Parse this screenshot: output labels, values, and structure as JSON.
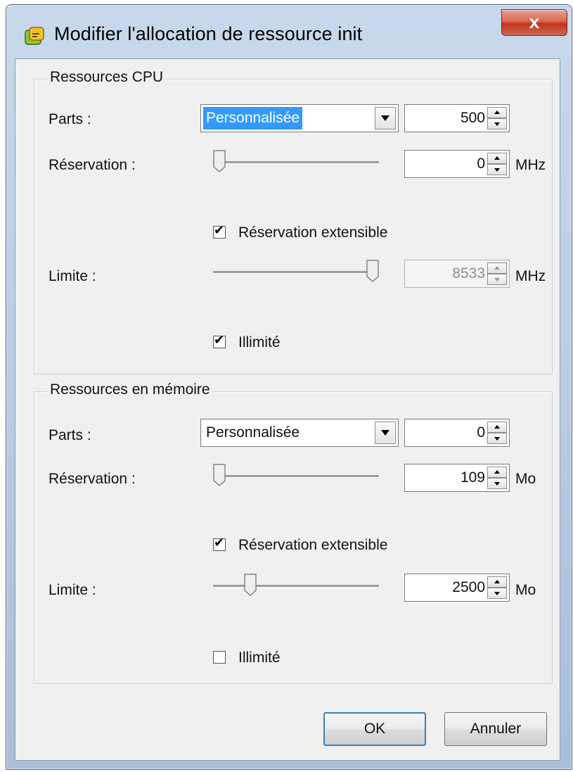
{
  "window": {
    "title": "Modifier l'allocation de ressource init",
    "close_label": "x"
  },
  "cpu": {
    "group_label": "Ressources CPU",
    "parts_label": "Parts :",
    "parts_value": "Personnalisée",
    "parts_number": "500",
    "reservation_label": "Réservation :",
    "reservation_value": "0",
    "reservation_slider_fraction": 0.0,
    "reservation_unit": "MHz",
    "expandable_label": "Réservation extensible",
    "expandable_checked": true,
    "limit_label": "Limite :",
    "limit_value": "8533",
    "limit_slider_fraction": 1.0,
    "limit_unit": "MHz",
    "unlimited_label": "Illimité",
    "unlimited_checked": true
  },
  "memory": {
    "group_label": "Ressources en mémoire",
    "parts_label": "Parts :",
    "parts_value": "Personnalisée",
    "parts_number": "0",
    "reservation_label": "Réservation :",
    "reservation_value": "109",
    "reservation_slider_fraction": 0.0,
    "reservation_unit": "Mo",
    "expandable_label": "Réservation extensible",
    "expandable_checked": true,
    "limit_label": "Limite :",
    "limit_value": "2500",
    "limit_slider_fraction": 0.2,
    "limit_unit": "Mo",
    "unlimited_label": "Illimité",
    "unlimited_checked": false
  },
  "buttons": {
    "ok_label": "OK",
    "cancel_label": "Annuler"
  },
  "colors": {
    "selection": "#3399ff",
    "close_button": "#c0341f"
  }
}
